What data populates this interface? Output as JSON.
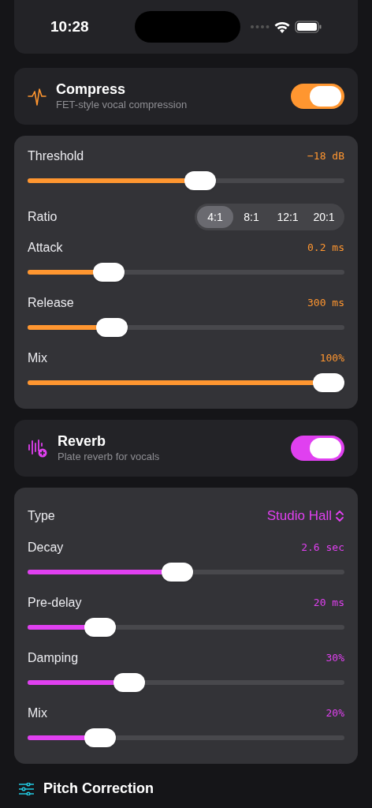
{
  "status_bar": {
    "time": "10:28"
  },
  "compress": {
    "title": "Compress",
    "subtitle": "FET-style vocal compression",
    "on": true,
    "color": "#ff9630",
    "params": [
      {
        "kind": "slider",
        "label": "Threshold",
        "reading": "−18 dB",
        "level": 0.55
      },
      {
        "kind": "segmented",
        "label": "Ratio",
        "options": [
          {
            "label": "4:1",
            "selected": true
          },
          {
            "label": "8:1",
            "selected": false
          },
          {
            "label": "12:1",
            "selected": false
          },
          {
            "label": "20:1",
            "selected": false
          }
        ]
      },
      {
        "kind": "slider",
        "label": "Attack",
        "reading": "0.2 ms",
        "level": 0.23
      },
      {
        "kind": "slider",
        "label": "Release",
        "reading": "300 ms",
        "level": 0.24
      },
      {
        "kind": "slider",
        "label": "Mix",
        "reading": "100%",
        "level": 1
      }
    ]
  },
  "reverb": {
    "title": "Reverb",
    "subtitle": "Plate reverb for vocals",
    "on": true,
    "color": "#e040f0",
    "params": [
      {
        "kind": "picker",
        "label": "Type",
        "value": "Studio Hall"
      },
      {
        "kind": "slider",
        "label": "Decay",
        "reading": "2.6 sec",
        "level": 0.47
      },
      {
        "kind": "slider",
        "label": "Pre-delay",
        "reading": "20 ms",
        "level": 0.2
      },
      {
        "kind": "slider",
        "label": "Damping",
        "reading": "30%",
        "level": 0.3
      },
      {
        "kind": "slider",
        "label": "Mix",
        "reading": "20%",
        "level": 0.2
      }
    ]
  },
  "next_section": {
    "title": "Pitch Correction"
  }
}
